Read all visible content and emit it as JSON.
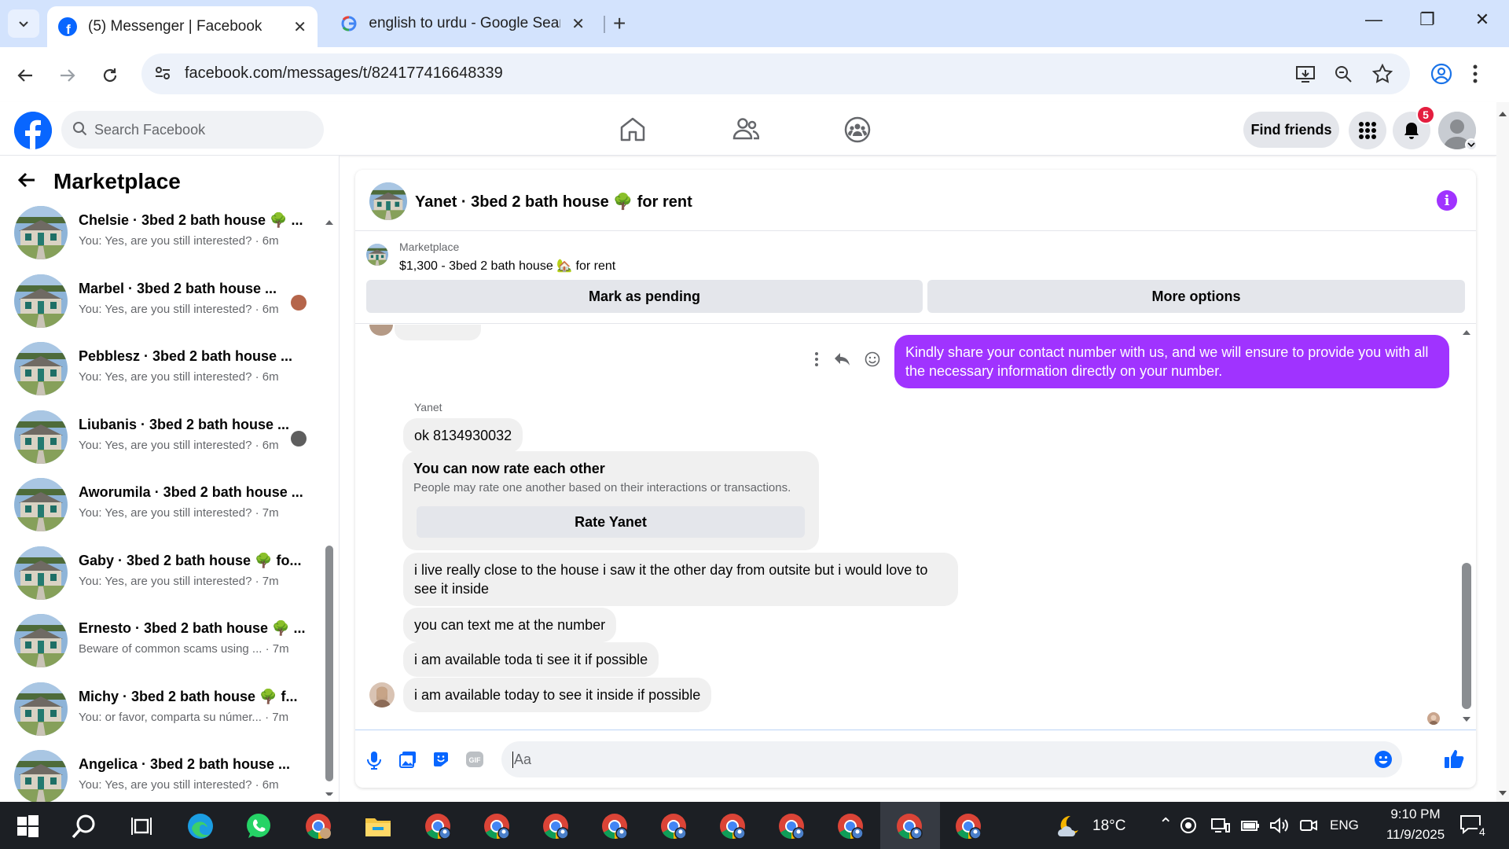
{
  "browser": {
    "tabs": [
      {
        "title": "(5) Messenger | Facebook",
        "active": true
      },
      {
        "title": "english to urdu - Google Search",
        "active": false
      }
    ],
    "url": "facebook.com/messages/t/824177416648339"
  },
  "facebook": {
    "search_placeholder": "Search Facebook",
    "find_friends": "Find friends",
    "notification_count": "5"
  },
  "sidebar": {
    "title": "Marketplace",
    "conversations": [
      {
        "name": "Chelsie · 3bed 2 bath house 🌳 ...",
        "preview": "You: Yes, are you still interested? · 6m"
      },
      {
        "name": "Marbel · 3bed 2 bath house ...",
        "preview": "You: Yes, are you still interested? · 6m"
      },
      {
        "name": "Pebblesz · 3bed 2 bath house ...",
        "preview": "You: Yes, are you still interested? · 6m"
      },
      {
        "name": "Liubanis · 3bed 2 bath house ...",
        "preview": "You: Yes, are you still interested? · 6m"
      },
      {
        "name": "Aworumila · 3bed 2 bath house ...",
        "preview": "You: Yes, are you still interested? · 7m"
      },
      {
        "name": "Gaby · 3bed 2 bath house 🌳 fo...",
        "preview": "You: Yes, are you still interested? · 7m"
      },
      {
        "name": "Ernesto · 3bed 2 bath house 🌳 ...",
        "preview": "Beware of common scams using ... · 7m"
      },
      {
        "name": "Michy · 3bed 2 bath house 🌳 f...",
        "preview": "You: or favor, comparta su númer... · 7m"
      },
      {
        "name": "Angelica · 3bed 2 bath house ...",
        "preview": "You: Yes, are you still interested? · 6m"
      }
    ]
  },
  "chat": {
    "title": "Yanet · 3bed 2 bath house 🌳 for rent",
    "listing_kind": "Marketplace",
    "listing_price": "$1,300 - 3bed 2 bath house 🏡 for rent",
    "mark_pending": "Mark as pending",
    "more_options": "More options",
    "outgoing": "Kindly share your contact number with us, and we will ensure to provide you with all the necessary information directly on your number.",
    "sender_name": "Yanet",
    "messages": [
      "ok  8134930032",
      "i live really close to the house i saw it the other day from outsite but i would love to see it inside",
      "you can text me at the number",
      "i am available toda ti see it if possible",
      "i am available today to see it inside if possible"
    ],
    "rate_title": "You can now rate each other",
    "rate_sub": "People may rate one another based on their interactions or transactions.",
    "rate_button": "Rate Yanet",
    "composer_placeholder": "Aa"
  },
  "taskbar": {
    "weather": "18°C",
    "lang": "ENG",
    "time": "9:10 PM",
    "date": "11/9/2025",
    "notif": "4"
  }
}
